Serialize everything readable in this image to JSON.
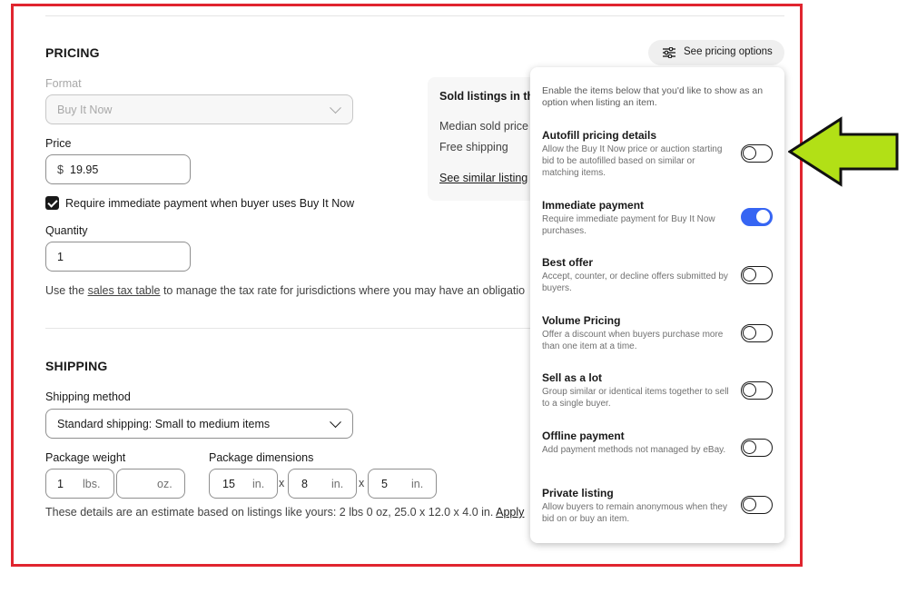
{
  "pricing": {
    "title": "PRICING",
    "see_pricing_button": "See pricing options",
    "format_label": "Format",
    "format_value": "Buy It Now",
    "price_label": "Price",
    "price_currency": "$",
    "price_value": "19.95",
    "immediate_payment_label": "Require immediate payment when buyer uses Buy It Now",
    "immediate_payment_checked": true,
    "quantity_label": "Quantity",
    "quantity_value": "1",
    "tax_prefix": "Use the ",
    "tax_link": "sales tax table",
    "tax_suffix": " to manage the tax rate for jurisdictions where you may have an obligatio"
  },
  "sold_panel": {
    "title": "Sold listings in the",
    "median": "Median sold price",
    "free_shipping": "Free shipping",
    "see_similar": "See similar listing"
  },
  "shipping": {
    "title": "SHIPPING",
    "method_label": "Shipping method",
    "method_value": "Standard shipping: Small to medium items",
    "weight_label": "Package weight",
    "weight_lbs": "1",
    "weight_lbs_unit": "lbs.",
    "weight_oz": "",
    "weight_oz_unit": "oz.",
    "dimensions_label": "Package dimensions",
    "dim_length": "15",
    "dim_width": "8",
    "dim_height": "5",
    "dim_unit": "in.",
    "dim_sep": "x",
    "estimate_text": "These details are an estimate based on listings like yours: 2 lbs 0 oz, 25.0 x 12.0 x 4.0 in.",
    "apply_link": "Apply"
  },
  "popup": {
    "intro": "Enable the items below that you'd like to show as an option when listing an item.",
    "options": [
      {
        "title": "Autofill pricing details",
        "desc": "Allow the Buy It Now price or auction starting bid to be autofilled based on similar or matching items.",
        "enabled": false
      },
      {
        "title": "Immediate payment",
        "desc": "Require immediate payment for Buy It Now purchases.",
        "enabled": true
      },
      {
        "title": "Best offer",
        "desc": "Accept, counter, or decline offers submitted by buyers.",
        "enabled": false
      },
      {
        "title": "Volume Pricing",
        "desc": "Offer a discount when buyers purchase more than one item at a time.",
        "enabled": false
      },
      {
        "title": "Sell as a lot",
        "desc": "Group similar or identical items together to sell to a single buyer.",
        "enabled": false
      },
      {
        "title": "Offline payment",
        "desc": "Add payment methods not managed by eBay.",
        "enabled": false
      },
      {
        "title": "Private listing",
        "desc": "Allow buyers to remain anonymous when they bid on or buy an item.",
        "enabled": false
      }
    ]
  },
  "colors": {
    "highlight_border": "#e0252f",
    "arrow_fill": "#b2e016",
    "toggle_on": "#3665f3"
  },
  "icons": {
    "pricing_options": "sliders-icon",
    "annotation": "green-arrow-left"
  }
}
